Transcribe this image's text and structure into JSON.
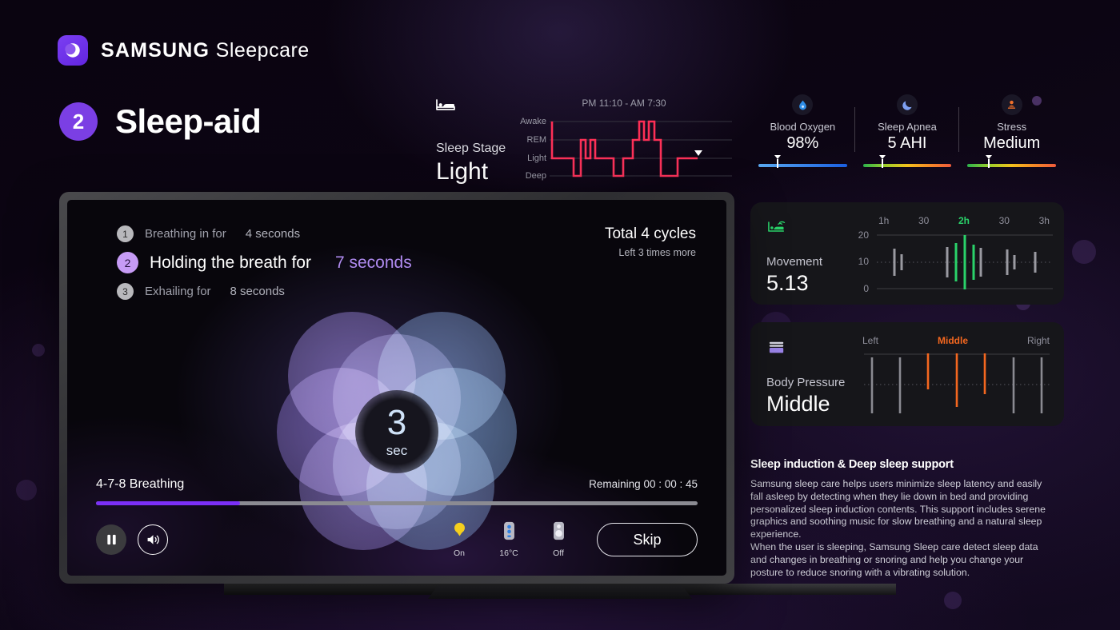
{
  "brand": {
    "samsung": "SAMSUNG",
    "product": "Sleepcare",
    "logo_icon": "moon-icon"
  },
  "header": {
    "step_number": "2",
    "title": "Sleep-aid"
  },
  "sleep_stage": {
    "icon": "bed-icon",
    "label": "Sleep Stage",
    "value": "Light",
    "time_range": "PM 11:10 - AM 7:30",
    "y_labels": [
      "Awake",
      "REM",
      "Light",
      "Deep"
    ]
  },
  "metrics": [
    {
      "icon": "droplet-icon",
      "name": "Blood Oxygen",
      "value": "98%",
      "marker_pct": 22,
      "bar": "blue"
    },
    {
      "icon": "moon-icon",
      "name": "Sleep Apnea",
      "value": "5 AHI",
      "marker_pct": 22,
      "bar": "warm"
    },
    {
      "icon": "person-icon",
      "name": "Stress",
      "value": "Medium",
      "marker_pct": 24,
      "bar": "warm"
    }
  ],
  "movement_card": {
    "icon": "bed-motion-icon",
    "label": "Movement",
    "value": "5.13",
    "x_ticks": [
      "1h",
      "30",
      "2h",
      "30",
      "3h"
    ],
    "x_active_index": 2,
    "y_ticks": [
      "20",
      "10",
      "0"
    ]
  },
  "pressure_card": {
    "icon": "mattress-icon",
    "label": "Body Pressure",
    "value": "Middle",
    "x_ticks": [
      "Left",
      "Middle",
      "Right"
    ],
    "x_active_index": 1
  },
  "description": {
    "heading": "Sleep induction & Deep sleep support",
    "paragraph1": "Samsung sleep care helps users minimize sleep latency and easily fall asleep by detecting when they lie down in bed and providing personalized sleep induction contents. This support includes serene graphics and soothing music for slow breathing and a natural sleep experience.",
    "paragraph2": "When the user is sleeping, Samsung Sleep care detect sleep data and changes in breathing or snoring and help you change your posture to reduce snoring with a vibrating solution."
  },
  "tv": {
    "steps": [
      {
        "num": "1",
        "text": "Breathing in for",
        "duration": "4 seconds",
        "active": false
      },
      {
        "num": "2",
        "text": "Holding the breath for",
        "duration": "7 seconds",
        "active": true
      },
      {
        "num": "3",
        "text": "Exhailing for",
        "duration": "8 seconds",
        "active": false
      }
    ],
    "cycles_total": "Total 4 cycles",
    "cycles_left": "Left 3 times more",
    "timer_value": "3",
    "timer_unit": "sec",
    "player": {
      "title": "4-7-8 Breathing",
      "remaining": "Remaining 00 : 00 : 45",
      "progress_pct": 24,
      "pause_icon": "pause-icon",
      "volume_icon": "volume-icon",
      "skip_label": "Skip"
    },
    "devices": [
      {
        "icon": "light-bulb-icon",
        "label": "On"
      },
      {
        "icon": "thermostat-icon",
        "label": "16°C"
      },
      {
        "icon": "air-purifier-icon",
        "label": "Off"
      }
    ]
  },
  "chart_data": [
    {
      "type": "line",
      "name": "hypnogram",
      "title": "Sleep Stage",
      "xlabel": "",
      "ylabel": "",
      "categories": [
        "Awake",
        "REM",
        "Light",
        "Deep"
      ],
      "x": [
        0,
        0,
        3,
        3,
        12,
        12,
        16,
        16,
        19,
        19,
        22,
        22,
        25,
        25,
        28,
        28,
        34,
        34,
        38,
        38,
        42,
        42,
        48,
        48,
        52,
        52,
        55,
        55,
        58,
        58,
        62,
        62,
        66,
        66,
        70,
        70,
        78,
        78,
        86,
        86,
        100
      ],
      "values": [
        "Awake",
        "Light",
        "Light",
        "Deep",
        "Deep",
        "Light",
        "Light",
        "REM",
        "REM",
        "Light",
        "Light",
        "REM",
        "REM",
        "Light",
        "Light",
        "Deep",
        "Deep",
        "Light",
        "Light",
        "REM",
        "REM",
        "Awake",
        "Awake",
        "REM",
        "REM",
        "Awake",
        "Awake",
        "REM",
        "REM",
        "Light",
        "Light",
        "Deep",
        "Deep",
        "Light",
        "Light",
        "Deep",
        "Deep",
        "Light",
        "Light",
        "Light",
        "Light"
      ],
      "time_range": "PM 11:10 - AM 7:30",
      "current_marker": "Light",
      "grid": true
    },
    {
      "type": "bar",
      "name": "movement",
      "title": "Movement",
      "ylabel": "",
      "ylim": [
        0,
        20
      ],
      "yticks": [
        0,
        10,
        20
      ],
      "categories": [
        "1h",
        "30",
        "2h",
        "30",
        "3h"
      ],
      "bars": [
        {
          "x_pct": 10,
          "amplitude": 4.2,
          "color": "gray"
        },
        {
          "x_pct": 14,
          "amplitude": 2.6,
          "color": "gray"
        },
        {
          "x_pct": 40,
          "amplitude": 4.8,
          "color": "gray"
        },
        {
          "x_pct": 45,
          "amplitude": 6.0,
          "color": "green"
        },
        {
          "x_pct": 50,
          "amplitude": 8.6,
          "color": "green"
        },
        {
          "x_pct": 55,
          "amplitude": 5.6,
          "color": "green"
        },
        {
          "x_pct": 59,
          "amplitude": 4.6,
          "color": "gray"
        },
        {
          "x_pct": 74,
          "amplitude": 4.0,
          "color": "gray"
        },
        {
          "x_pct": 78,
          "amplitude": 2.4,
          "color": "gray"
        },
        {
          "x_pct": 90,
          "amplitude": 3.4,
          "color": "gray"
        }
      ]
    },
    {
      "type": "bar",
      "name": "body_pressure",
      "title": "Body Pressure",
      "categories": [
        "Left",
        "Middle",
        "Right"
      ],
      "bars": [
        {
          "x_pct": 5,
          "top_pct": 8,
          "bottom_pct": 100,
          "color": "gray"
        },
        {
          "x_pct": 20,
          "top_pct": 8,
          "bottom_pct": 100,
          "color": "gray"
        },
        {
          "x_pct": 35,
          "top_pct": 2,
          "bottom_pct": 58,
          "color": "orange"
        },
        {
          "x_pct": 50,
          "top_pct": 2,
          "bottom_pct": 86,
          "color": "orange"
        },
        {
          "x_pct": 65,
          "top_pct": 2,
          "bottom_pct": 66,
          "color": "orange"
        },
        {
          "x_pct": 80,
          "top_pct": 8,
          "bottom_pct": 100,
          "color": "gray"
        },
        {
          "x_pct": 95,
          "top_pct": 8,
          "bottom_pct": 100,
          "color": "gray"
        }
      ]
    }
  ]
}
